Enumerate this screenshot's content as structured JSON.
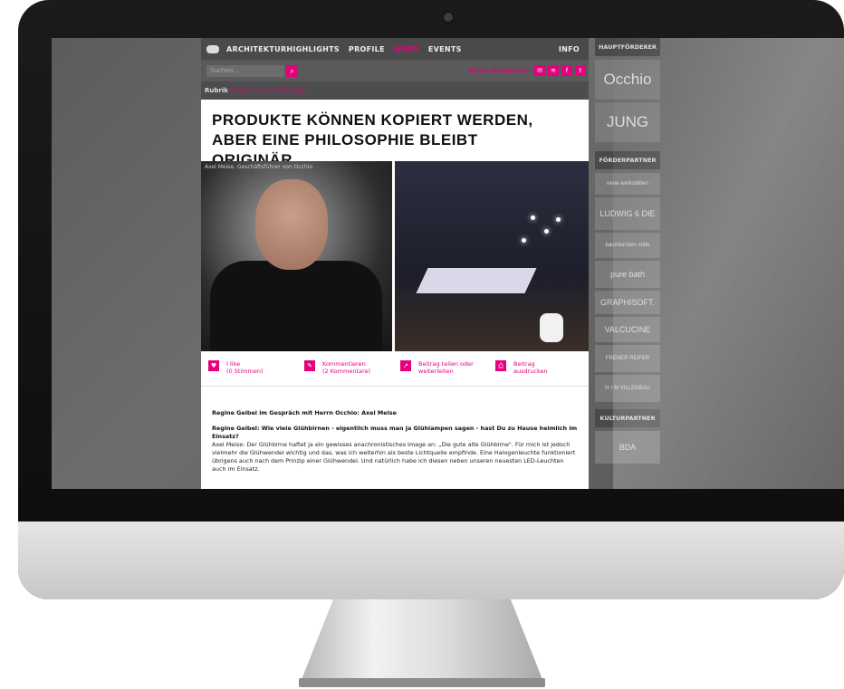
{
  "nav": {
    "items": [
      "ARCHITEKTURHIGHLIGHTS",
      "PROFILE",
      "NEWS",
      "EVENTS"
    ],
    "active": "NEWS",
    "info": "INFO"
  },
  "search": {
    "placeholder": "Suchen...",
    "subscribe": "News abonnieren"
  },
  "breadcrumb": {
    "label": "Rubrik",
    "path": "News > Kunst & Design"
  },
  "article": {
    "title": "PRODUKTE KÖNNEN KOPIERT WERDEN, ABER EINE PHILOSOPHIE BLEIBT ORIGINÄR...",
    "photo_caption": "Axel Meise, Geschäftsführer von Occhio",
    "actions": [
      {
        "label": "I like\n(0 Stimmen)"
      },
      {
        "label": "Kommentieren\n(2 Kommentare)"
      },
      {
        "label": "Beitrag teilen oder\nweiterleiten"
      },
      {
        "label": "Beitrag\nausdrucken"
      }
    ],
    "intro": "Regine Geibel im Gespräch mit Herrn Occhio: Axel Meise",
    "question": "Regine Geibel: Wie viele Glühbirnen - eigentlich muss man ja Glühlampen sagen - hast Du zu Hause heimlich im Einsatz?",
    "answer": "Axel Meise: Der Glühbirne haftet ja ein gewisses anachronistisches Image an: „Die gute alte Glühbirne\". Für mich ist jedoch vielmehr die Glühwendel wichtig und das, was ich weiterhin als beste Lichtquelle empfinde. Eine Halogenleuchte funktioniert übrigens auch nach dem Prinzip einer Glühwendel. Und natürlich habe ich diesen neben unseren neuesten LED-Leuchten auch im Einsatz."
  },
  "sidebar": {
    "main_header": "HAUPTFÖRDERER",
    "main": [
      "Occhio",
      "JUNG"
    ],
    "partner_header": "FÖRDERPARTNER",
    "partners": [
      "neue werkstätten",
      "LUDWIG 6 DIE KÜCHE",
      "baumkirchen mitte",
      "pure bath",
      "GRAPHISOFT.",
      "VALCUCINE",
      "FRENER REIFER",
      "H·I·M VILLENBAU"
    ],
    "culture_header": "KULTURPARTNER",
    "culture": [
      "BDA"
    ]
  },
  "colors": {
    "accent": "#e5007e",
    "nav_bg": "#4a4a4a"
  }
}
